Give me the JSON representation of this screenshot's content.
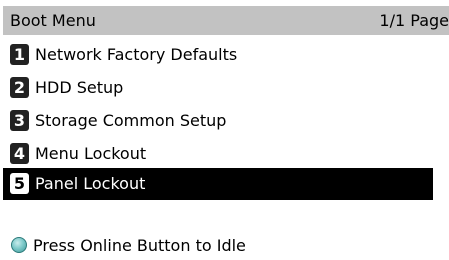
{
  "header": {
    "title": "Boot Menu",
    "page_indicator": "1/1 Page"
  },
  "menu": {
    "items": [
      {
        "number": "1",
        "label": "Network Factory Defaults",
        "selected": false
      },
      {
        "number": "2",
        "label": "HDD Setup",
        "selected": false
      },
      {
        "number": "3",
        "label": "Storage Common Setup",
        "selected": false
      },
      {
        "number": "4",
        "label": "Menu Lockout",
        "selected": false
      },
      {
        "number": "5",
        "label": "Panel Lockout",
        "selected": true
      }
    ]
  },
  "status": {
    "icon": "status-indicator-icon",
    "icon_color": "#7fcaca",
    "text": "Press Online Button to Idle"
  },
  "colors": {
    "title_bar": "#c2c2c2",
    "selected_background": "#000000",
    "selected_text": "#ffffff"
  }
}
